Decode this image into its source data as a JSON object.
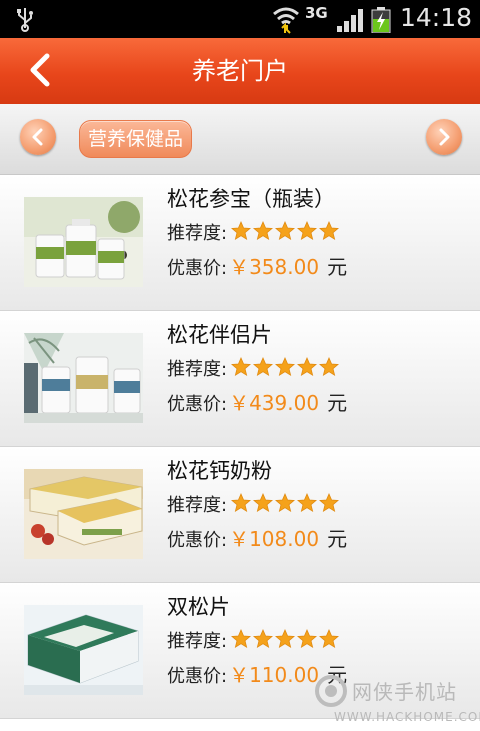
{
  "status_bar": {
    "network": "3G",
    "time": "14:18",
    "icons": [
      "usb-icon",
      "wifi-icon",
      "signal-icon",
      "battery-charging-icon"
    ]
  },
  "header": {
    "title": "养老门户",
    "back_icon": "chevron-left-icon"
  },
  "category_bar": {
    "active_category": "营养保健品",
    "prev_icon": "chevron-left-icon",
    "next_icon": "chevron-right-icon"
  },
  "labels": {
    "rating": "推荐度:",
    "price": "优惠价:",
    "unit": "元"
  },
  "products": [
    {
      "name": "松花参宝（瓶装）",
      "price": "￥358.00",
      "rating": 5
    },
    {
      "name": "松花伴侣片",
      "price": "￥439.00",
      "rating": 5
    },
    {
      "name": "松花钙奶粉",
      "price": "￥108.00",
      "rating": 5
    },
    {
      "name": "双松片",
      "price": "￥110.00",
      "rating": 5
    }
  ],
  "colors": {
    "header": "#e8461b",
    "price": "#f28a1a",
    "star": "#f5a21b",
    "chip": "#f08a5a"
  },
  "watermark": {
    "name": "网侠手机站",
    "url": "WWW.HACKHOME.COM"
  }
}
